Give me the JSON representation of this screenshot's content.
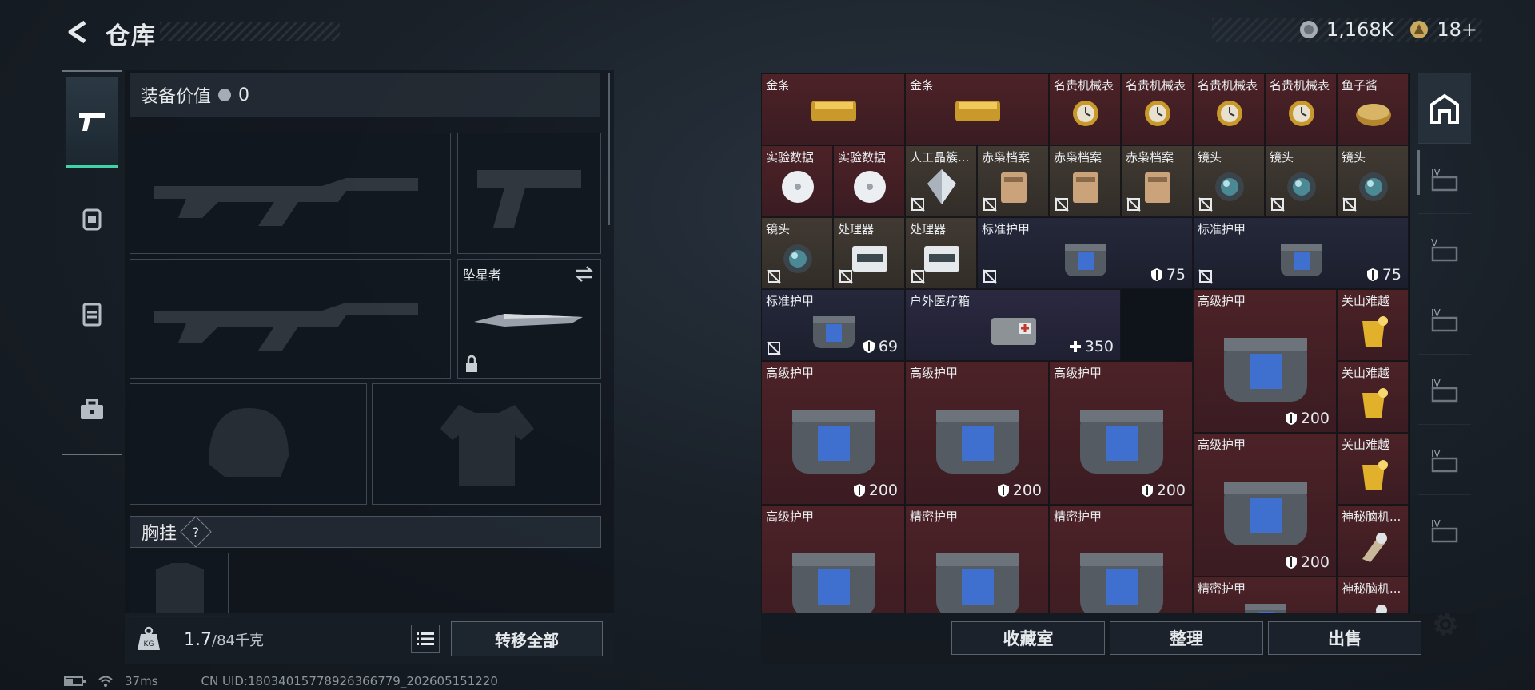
{
  "header": {
    "title": "仓库",
    "currency_amount": "1,168K",
    "tickets": "18+"
  },
  "side_nav": [
    "weapons-icon",
    "backpack-icon",
    "vest-icon",
    "toolbox-icon"
  ],
  "loadout": {
    "equip_value_label": "装备价值",
    "equip_value": "0",
    "melee_name": "坠星者",
    "chest_rig_label": "胸挂",
    "chest_help": "?",
    "weight_current": "1.7",
    "weight_max": "/84千克",
    "transfer_all": "转移全部"
  },
  "inventory": {
    "items": [
      {
        "label": "金条",
        "color": "red",
        "icon": "gold-bar-icon"
      },
      {
        "label": "金条",
        "color": "red",
        "icon": "gold-bar-icon"
      },
      {
        "label": "名贵机械表",
        "color": "red",
        "icon": "watch-icon"
      },
      {
        "label": "名贵机械表",
        "color": "red",
        "icon": "watch-icon"
      },
      {
        "label": "名贵机械表",
        "color": "red",
        "icon": "watch-icon"
      },
      {
        "label": "名贵机械表",
        "color": "red",
        "icon": "watch-icon"
      },
      {
        "label": "鱼子酱",
        "color": "red",
        "icon": "caviar-icon"
      },
      {
        "label": "实验数据",
        "color": "red",
        "icon": "disc-icon"
      },
      {
        "label": "实验数据",
        "color": "red",
        "icon": "disc-icon"
      },
      {
        "label": "人工晶簇...",
        "color": "brown",
        "icon": "crystal-icon"
      },
      {
        "label": "赤枭档案",
        "color": "brown",
        "icon": "file-icon"
      },
      {
        "label": "赤枭档案",
        "color": "brown",
        "icon": "file-icon"
      },
      {
        "label": "赤枭档案",
        "color": "brown",
        "icon": "file-icon"
      },
      {
        "label": "镜头",
        "color": "brown",
        "icon": "lens-icon"
      },
      {
        "label": "镜头",
        "color": "brown",
        "icon": "lens-icon"
      },
      {
        "label": "镜头",
        "color": "brown",
        "icon": "lens-icon"
      },
      {
        "label": "镜头",
        "color": "brown",
        "icon": "lens-icon"
      },
      {
        "label": "处理器",
        "color": "brown",
        "icon": "processor-icon"
      },
      {
        "label": "处理器",
        "color": "brown",
        "icon": "processor-icon"
      },
      {
        "label": "标准护甲",
        "color": "navy",
        "icon": "armor-icon",
        "value": "75"
      },
      {
        "label": "标准护甲",
        "color": "navy",
        "icon": "armor-icon",
        "value": "75"
      },
      {
        "label": "标准护甲",
        "color": "navy",
        "icon": "armor-icon",
        "value": "69"
      },
      {
        "label": "户外医疗箱",
        "color": "purple",
        "icon": "medkit-icon",
        "value": "350"
      },
      {
        "label": "高级护甲",
        "color": "red",
        "icon": "armor-icon",
        "value": "200"
      },
      {
        "label": "关山难越",
        "color": "red",
        "icon": "drink-icon"
      },
      {
        "label": "高级护甲",
        "color": "red",
        "icon": "armor-icon",
        "value": "200"
      },
      {
        "label": "高级护甲",
        "color": "red",
        "icon": "armor-icon",
        "value": "200"
      },
      {
        "label": "高级护甲",
        "color": "red",
        "icon": "armor-icon",
        "value": "200"
      },
      {
        "label": "关山难越",
        "color": "red",
        "icon": "drink-icon"
      },
      {
        "label": "高级护甲",
        "color": "red",
        "icon": "armor-icon",
        "value": "200"
      },
      {
        "label": "关山难越",
        "color": "red",
        "icon": "drink-icon"
      },
      {
        "label": "高级护甲",
        "color": "red",
        "icon": "armor-icon"
      },
      {
        "label": "精密护甲",
        "color": "red",
        "icon": "armor-icon"
      },
      {
        "label": "精密护甲",
        "color": "red",
        "icon": "armor-icon"
      },
      {
        "label": "神秘脑机...",
        "color": "red",
        "icon": "brain-chip-icon"
      },
      {
        "label": "精密护甲",
        "color": "red",
        "icon": "armor-icon"
      },
      {
        "label": "神秘脑机...",
        "color": "red",
        "icon": "brain-chip-icon"
      }
    ]
  },
  "actions": {
    "collection": "收藏室",
    "sort": "整理",
    "sell": "出售"
  },
  "rail": [
    "safehouse-icon",
    "room-IV-icon",
    "room-V-icon",
    "room-IV-icon",
    "room-IV-icon",
    "room-IV-icon",
    "room-IV-icon"
  ],
  "status": {
    "ping": "37ms",
    "uid": "CN UID:1803401577892636677­9_202605151220"
  },
  "colors": {
    "accent": "#3fd3a6",
    "red_cell": "#4c2227",
    "brown_cell": "#413a33",
    "navy_cell": "#24283a"
  }
}
